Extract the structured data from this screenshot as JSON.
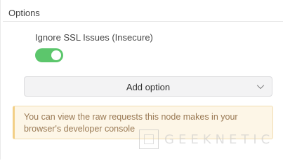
{
  "section": {
    "title": "Options"
  },
  "option": {
    "label": "Ignore SSL Issues (Insecure)",
    "enabled": true,
    "toggle_color": "#5cc66c"
  },
  "add_option": {
    "label": "Add option",
    "icon": "chevron-down-icon"
  },
  "notice": {
    "text": "You can view the raw requests this node makes in your browser's developer console"
  },
  "watermark": {
    "text": "GEEKNETIC"
  }
}
